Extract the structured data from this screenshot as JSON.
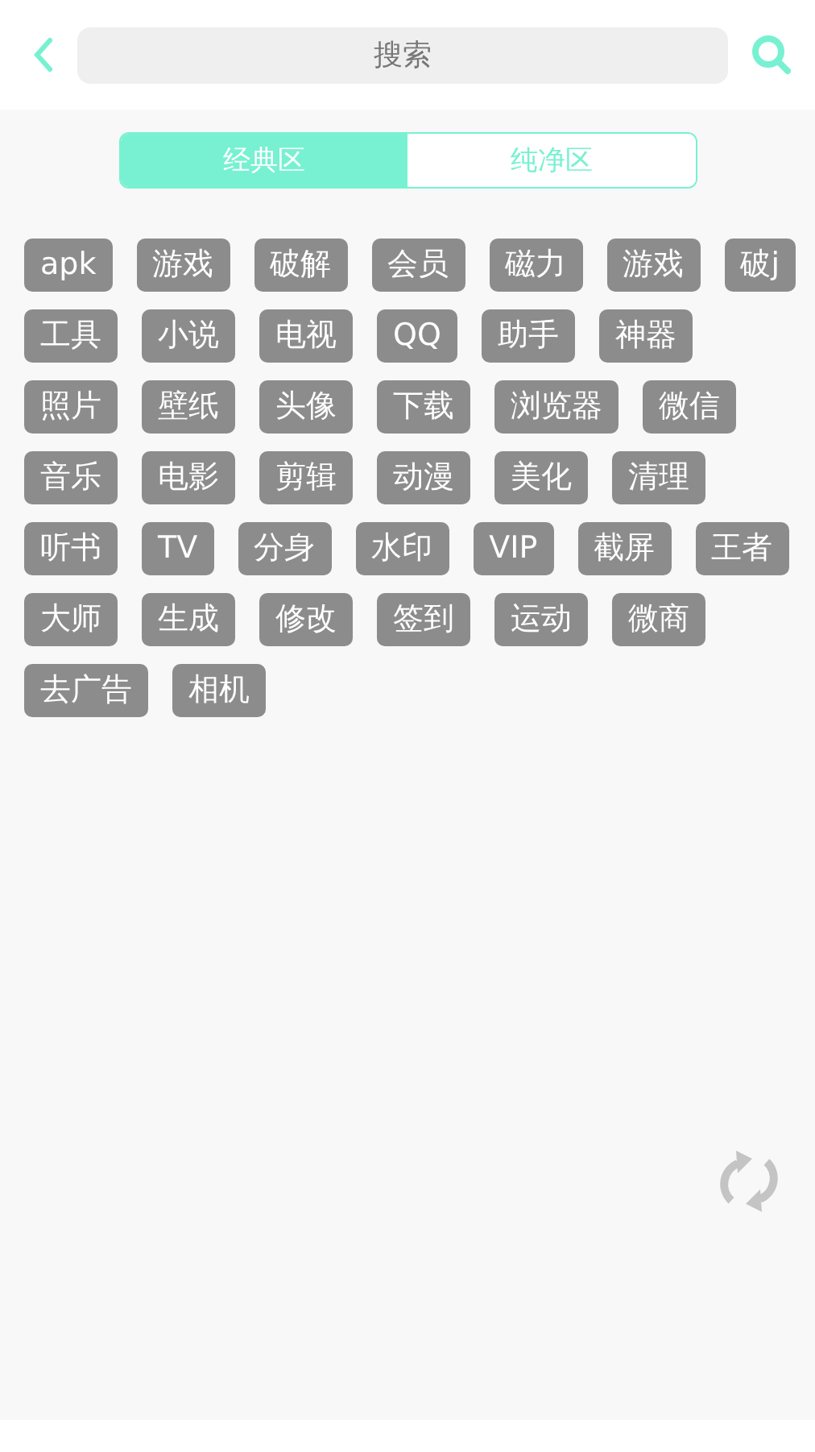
{
  "header": {
    "search_placeholder": "搜索"
  },
  "tabs": [
    {
      "label": "经典区",
      "selected": true
    },
    {
      "label": "纯净区",
      "selected": false
    }
  ],
  "tag_rows": [
    [
      "apk",
      "游戏",
      "破解",
      "会员",
      "磁力",
      "游戏",
      "破j"
    ],
    [
      "工具",
      "小说",
      "电视",
      "QQ",
      "助手",
      "神器"
    ],
    [
      "照片",
      "壁纸",
      "头像",
      "下载",
      "浏览器",
      "微信"
    ],
    [
      "音乐",
      "电影",
      "剪辑",
      "动漫",
      "美化",
      "清理"
    ],
    [
      "听书",
      "TV",
      "分身",
      "水印",
      "VIP",
      "截屏",
      "王者"
    ],
    [
      "大师",
      "生成",
      "修改",
      "签到",
      "运动",
      "微商"
    ],
    [
      "去广告",
      "相机"
    ]
  ]
}
